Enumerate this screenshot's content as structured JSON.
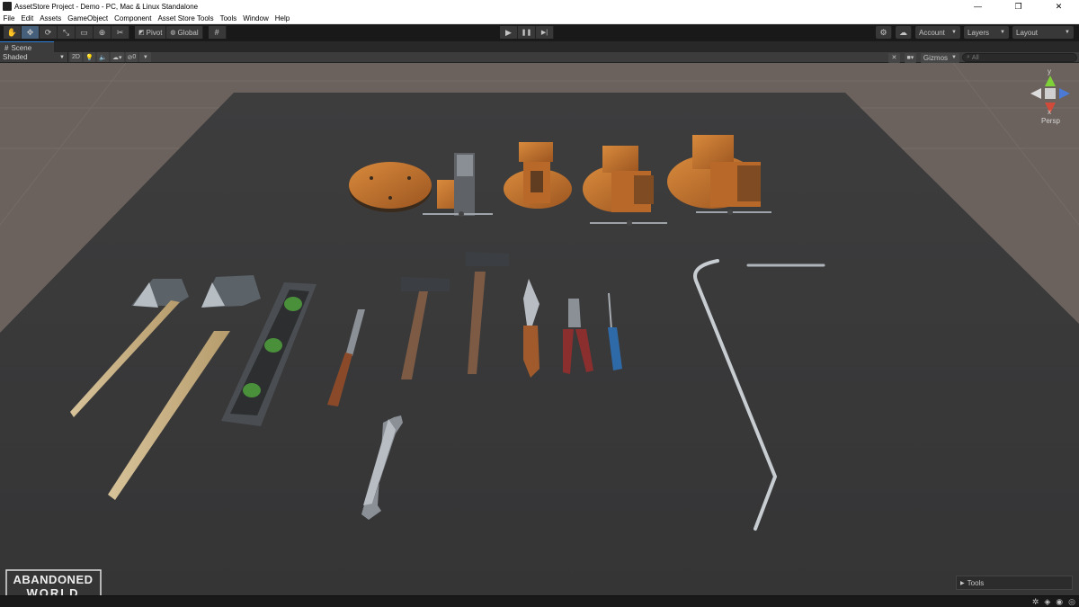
{
  "window": {
    "title": "AssetStore Project - Demo - PC, Mac & Linux Standalone",
    "minimize": "—",
    "maximize": "❐",
    "close": "✕"
  },
  "menu": [
    "File",
    "Edit",
    "Assets",
    "GameObject",
    "Component",
    "Asset Store Tools",
    "Tools",
    "Window",
    "Help"
  ],
  "toolbar": {
    "tools": [
      {
        "name": "hand-tool",
        "icon": "✋"
      },
      {
        "name": "move-tool",
        "icon": "✥"
      },
      {
        "name": "rotate-tool",
        "icon": "⟳"
      },
      {
        "name": "scale-tool",
        "icon": "⤡"
      },
      {
        "name": "rect-tool",
        "icon": "▭"
      },
      {
        "name": "transform-tool",
        "icon": "⊕"
      },
      {
        "name": "custom-tool",
        "icon": "✂"
      }
    ],
    "pivot_label": "Pivot",
    "global_label": "Global",
    "grid_icon": "#",
    "play_icon": "▶",
    "pause_icon": "❚❚",
    "step_icon": "▶|",
    "account_label": "Account",
    "layers_label": "Layers",
    "layout_label": "Layout"
  },
  "scene_tab": {
    "label": "Scene"
  },
  "scene_toolbar": {
    "shading_mode": "Shaded",
    "mode_2d": "2D",
    "hidden_count": "0",
    "gizmos_label": "Gizmos",
    "search_placeholder": "All"
  },
  "orientation_gizmo": {
    "y_label": "y",
    "x_label": "x",
    "persp_label": "Persp"
  },
  "tools_overlay": {
    "label": "Tools"
  },
  "watermark": {
    "line1": "ABANDONED",
    "line2": "WORLD"
  },
  "colors": {
    "accent": "#2b7fd6",
    "floor": "#3a3a3b",
    "horizon": "#6c625d",
    "rust": "#c9742c"
  }
}
